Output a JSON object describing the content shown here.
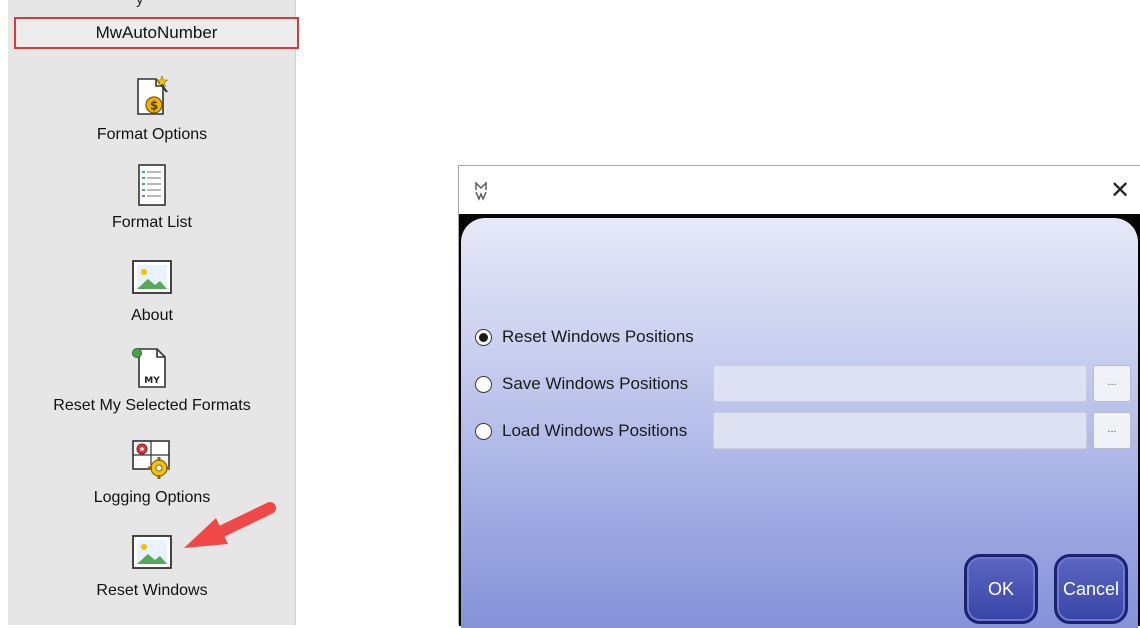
{
  "ribbon": {
    "group_label": "MwAutoNumber",
    "peek_text": "y",
    "buttons": [
      {
        "label": "Format Options",
        "icon": "format-options-icon"
      },
      {
        "label": "Format List",
        "icon": "format-list-icon"
      },
      {
        "label": "About",
        "icon": "image-icon"
      },
      {
        "label": "Reset My Selected Formats",
        "icon": "my-document-icon"
      },
      {
        "label": "Logging Options",
        "icon": "logging-gear-icon"
      },
      {
        "label": "Reset Windows",
        "icon": "image-icon"
      }
    ]
  },
  "annotation": {
    "arrow_color": "#f04848"
  },
  "dialog": {
    "icon": "mw-logo-icon",
    "close_glyph": "✕",
    "options": [
      {
        "label": "Reset Windows Positions",
        "checked": true
      },
      {
        "label": "Save Windows Positions",
        "checked": false
      },
      {
        "label": "Load Windows Positions",
        "checked": false
      }
    ],
    "save_path": "",
    "load_path": "",
    "browse_label": "...",
    "ok_label": "OK",
    "cancel_label": "Cancel"
  },
  "colors": {
    "highlight_border": "#d63a3a",
    "button_fill": "#3a44a6",
    "button_border": "#1c2270"
  }
}
